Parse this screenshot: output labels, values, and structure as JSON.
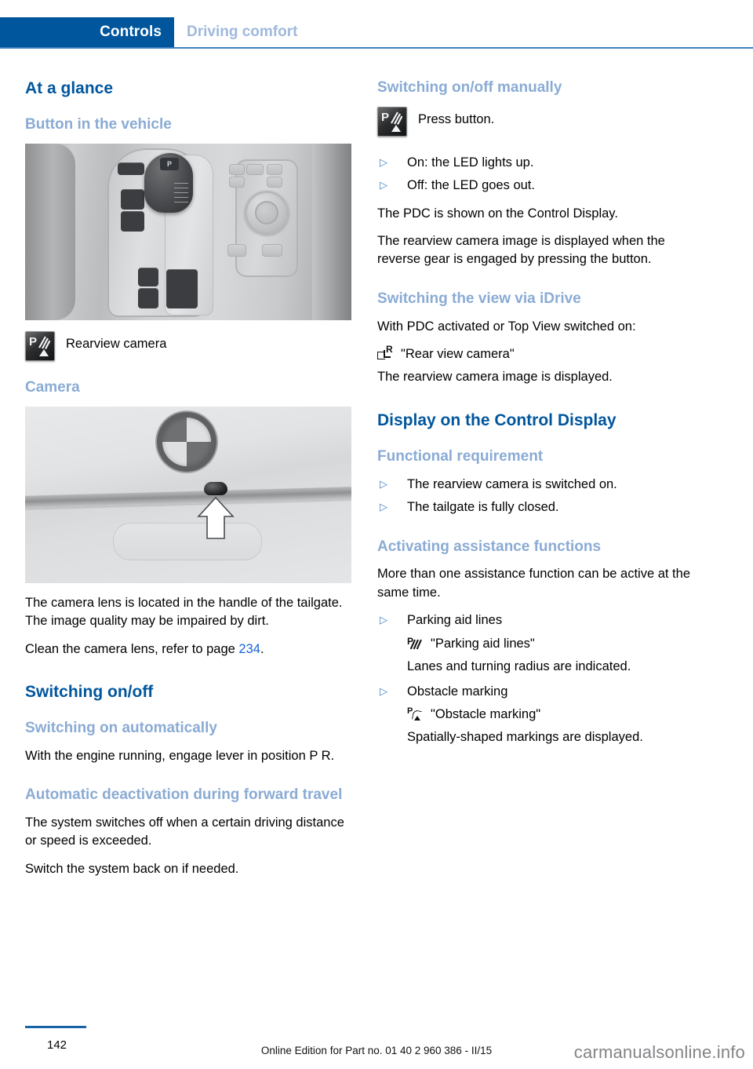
{
  "header": {
    "active_tab": "Controls",
    "inactive_tab": "Driving comfort"
  },
  "left_column": {
    "heading_at_a_glance": "At a glance",
    "heading_button_in_vehicle": "Button in the vehicle",
    "console_figure_alt": "Center console with gear selector and iDrive controller",
    "legend_icon_name": "pdc-rearview-camera-icon",
    "legend_label": "Rearview camera",
    "heading_camera": "Camera",
    "tailgate_figure_alt": "Tailgate with BMW roundel and camera lens above the license plate recess",
    "para_lens": "The camera lens is located in the handle of the tailgate. The image quality may be impaired by dirt.",
    "para_clean_prefix": "Clean the camera lens, refer to page ",
    "para_clean_page": "234",
    "para_clean_suffix": ".",
    "heading_switching_on_off": "Switching on/off",
    "heading_switching_on_auto": "Switching on automatically",
    "para_engine_running": "With the engine running, engage lever in position P R.",
    "heading_auto_deactivation": "Automatic deactivation during forward travel",
    "para_system_switches_off": "The system switches off when a certain driving distance or speed is exceeded.",
    "para_switch_back_on": "Switch the system back on if needed."
  },
  "right_column": {
    "heading_switching_manually": "Switching on/off manually",
    "press_button_icon_name": "pdc-rearview-camera-icon",
    "press_button_label": "Press button.",
    "bullets_led": [
      "On: the LED lights up.",
      "Off: the LED goes out."
    ],
    "para_pdc_shown": "The PDC is shown on the Control Display.",
    "para_rearview_displayed": "The rearview camera image is displayed when the reverse gear is engaged by pressing the button.",
    "heading_switch_view_idrive": "Switching the view via iDrive",
    "para_with_pdc_activated": "With PDC activated or Top View switched on:",
    "menu_rear_view_camera": "\"Rear view camera\"",
    "para_rearview_is_displayed": "The rearview camera image is displayed.",
    "heading_display_on_control_display": "Display on the Control Display",
    "heading_functional_requirement": "Functional requirement",
    "bullets_functional": [
      "The rearview camera is switched on.",
      "The tailgate is fully closed."
    ],
    "heading_activating_assistance": "Activating assistance functions",
    "para_more_than_one": "More than one assistance function can be active at the same time.",
    "assistance": [
      {
        "bullet": "Parking aid lines",
        "menu": "\"Parking aid lines\"",
        "description": "Lanes and turning radius are indicated."
      },
      {
        "bullet": "Obstacle marking",
        "menu": "\"Obstacle marking\"",
        "description": "Spatially-shaped markings are displayed."
      }
    ]
  },
  "footer": {
    "page_number": "142",
    "edition_note": "Online Edition for Part no. 01 40 2 960 386 - II/15",
    "watermark": "carmanualsonline.info"
  },
  "symbols": {
    "bullet_marker": "▷"
  },
  "colors": {
    "brand_blue": "#00569d",
    "heading_light_blue": "#8aabd4",
    "rule_blue": "#3f7fbf",
    "link_blue": "#1763d6"
  }
}
